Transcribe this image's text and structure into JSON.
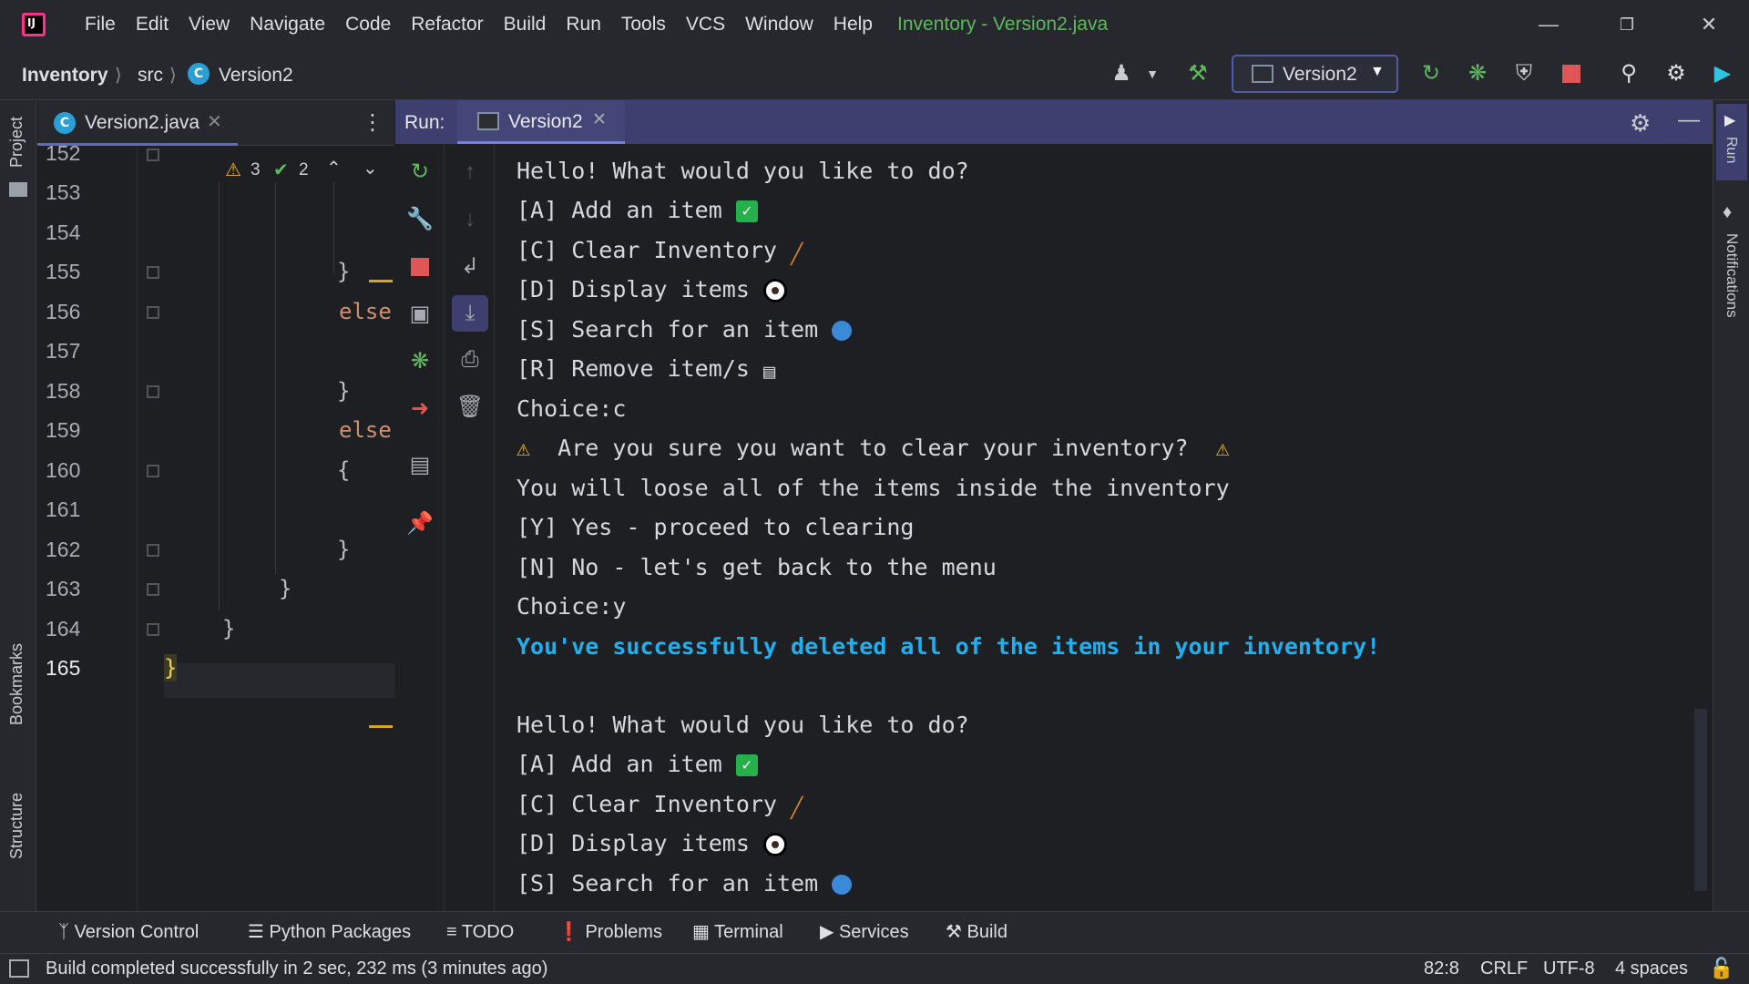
{
  "menu": [
    "File",
    "Edit",
    "View",
    "Navigate",
    "Code",
    "Refactor",
    "Build",
    "Run",
    "Tools",
    "VCS",
    "Window",
    "Help"
  ],
  "window_title": "Inventory - Version2.java",
  "breadcrumb": {
    "project": "Inventory",
    "folder": "src",
    "file": "Version2"
  },
  "run_config": "Version2",
  "editor": {
    "tab_label": "Version2.java",
    "inspections": {
      "warnings": "3",
      "checks": "2"
    },
    "line_numbers": [
      "152",
      "153",
      "154",
      "155",
      "156",
      "157",
      "158",
      "159",
      "160",
      "161",
      "162",
      "163",
      "164",
      "165"
    ],
    "code": {
      "l155": "}",
      "l156": "else",
      "l158": "}",
      "l159": "else",
      "l160": "{",
      "l162": "}",
      "l163": "}",
      "l164": "}",
      "l165": "}"
    }
  },
  "run_panel": {
    "label": "Run:",
    "tab": "Version2"
  },
  "console": [
    "Hello! What would you like to do?",
    "[A] Add an item",
    "[C] Clear Inventory",
    "[D] Display items",
    "[S] Search for an item",
    "[R] Remove item/s",
    "Choice:c",
    "Are you sure you want to clear your inventory?",
    "You will loose all of the items inside the inventory",
    "[Y] Yes - proceed to clearing",
    "[N] No - let's get back to the menu",
    "Choice:y",
    "You've successfully deleted all of the items in your inventory!",
    "",
    "Hello! What would you like to do?",
    "[A] Add an item",
    "[C] Clear Inventory",
    "[D] Display items",
    "[S] Search for an item"
  ],
  "left_strip": [
    "Project",
    "Bookmarks",
    "Structure"
  ],
  "right_strip": [
    "Run",
    "Notifications"
  ],
  "bottom_tools": [
    "Version Control",
    "Python Packages",
    "TODO",
    "Problems",
    "Terminal",
    "Services",
    "Build"
  ],
  "status": {
    "message": "Build completed successfully in 2 sec, 232 ms (3 minutes ago)",
    "position": "82:8",
    "line_sep": "CRLF",
    "encoding": "UTF-8",
    "indent": "4 spaces"
  },
  "colors": {
    "accent": "#3e3f6e",
    "success_text": "#1fb0f0",
    "title_green": "#5fb85f",
    "warning": "#f0b429"
  }
}
